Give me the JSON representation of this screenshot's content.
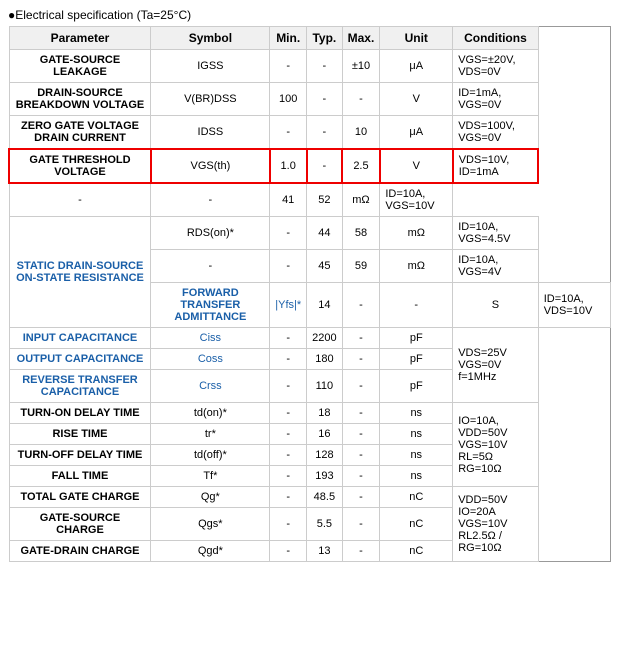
{
  "title": "Electrical specification (Ta=25°C)",
  "table": {
    "headers": [
      "Parameter",
      "Symbol",
      "Min.",
      "Typ.",
      "Max.",
      "Unit",
      "Conditions"
    ],
    "rows": [
      {
        "param": "GATE-SOURCE LEAKAGE",
        "symbol": "IGSS",
        "min": "-",
        "typ": "-",
        "max": "±10",
        "unit": "μA",
        "conditions": "VGS=±20V, VDS=0V",
        "highlight": false,
        "blue": false
      },
      {
        "param": "DRAIN-SOURCE BREAKDOWN VOLTAGE",
        "symbol": "V(BR)DSS",
        "min": "100",
        "typ": "-",
        "max": "-",
        "unit": "V",
        "conditions": "ID=1mA, VGS=0V",
        "highlight": false,
        "blue": false
      },
      {
        "param": "ZERO GATE VOLTAGE DRAIN CURRENT",
        "symbol": "IDSS",
        "min": "-",
        "typ": "-",
        "max": "10",
        "unit": "μA",
        "conditions": "VDS=100V, VGS=0V",
        "highlight": false,
        "blue": false
      },
      {
        "param": "GATE THRESHOLD VOLTAGE",
        "symbol": "VGS(th)",
        "min": "1.0",
        "typ": "-",
        "max": "2.5",
        "unit": "V",
        "conditions": "VDS=10V, ID=1mA",
        "highlight": true,
        "blue": false
      },
      {
        "param": "",
        "symbol": "-",
        "min": "-",
        "typ": "41",
        "max": "52",
        "unit": "mΩ",
        "conditions": "ID=10A, VGS=10V",
        "highlight": false,
        "blue": false,
        "subrow": true
      },
      {
        "param": "STATIC DRAIN-SOURCE ON-STATE RESISTANCE",
        "symbol": "RDS(on)*",
        "min": "-",
        "typ": "44",
        "max": "58",
        "unit": "mΩ",
        "conditions": "ID=10A, VGS=4.5V",
        "highlight": false,
        "blue": false,
        "multirow": true
      },
      {
        "param": "",
        "symbol": "-",
        "min": "-",
        "typ": "45",
        "max": "59",
        "unit": "mΩ",
        "conditions": "ID=10A, VGS=4V",
        "highlight": false,
        "blue": false,
        "subrow": true
      },
      {
        "param": "FORWARD TRANSFER ADMITTANCE",
        "symbol": "|Yfs|*",
        "min": "14",
        "typ": "-",
        "max": "-",
        "unit": "S",
        "conditions": "ID=10A, VDS=10V",
        "highlight": false,
        "blue": true
      },
      {
        "param": "INPUT CAPACITANCE",
        "symbol": "Ciss",
        "min": "-",
        "typ": "2200",
        "max": "-",
        "unit": "pF",
        "conditions": "",
        "highlight": false,
        "blue": true,
        "condgroup": "VDS=25V\nVGS=0V\nf=1MHz"
      },
      {
        "param": "OUTPUT CAPACITANCE",
        "symbol": "Coss",
        "min": "-",
        "typ": "180",
        "max": "-",
        "unit": "pF",
        "conditions": "",
        "highlight": false,
        "blue": true
      },
      {
        "param": "REVERSE TRANSFER CAPACITANCE",
        "symbol": "Crss",
        "min": "-",
        "typ": "110",
        "max": "-",
        "unit": "pF",
        "conditions": "",
        "highlight": false,
        "blue": true
      },
      {
        "param": "TURN-ON DELAY TIME",
        "symbol": "td(on)*",
        "min": "-",
        "typ": "18",
        "max": "-",
        "unit": "ns",
        "conditions": "",
        "highlight": false,
        "blue": false,
        "condgroup": "IO=10A, VDD=50V\nVGS=10V\nRL=5Ω\nRG=10Ω"
      },
      {
        "param": "RISE TIME",
        "symbol": "tr*",
        "min": "-",
        "typ": "16",
        "max": "-",
        "unit": "ns",
        "conditions": "",
        "highlight": false,
        "blue": false
      },
      {
        "param": "TURN-OFF DELAY TIME",
        "symbol": "td(off)*",
        "min": "-",
        "typ": "128",
        "max": "-",
        "unit": "ns",
        "conditions": "",
        "highlight": false,
        "blue": false
      },
      {
        "param": "FALL TIME",
        "symbol": "Tf*",
        "min": "-",
        "typ": "193",
        "max": "-",
        "unit": "ns",
        "conditions": "",
        "highlight": false,
        "blue": false
      },
      {
        "param": "TOTAL GATE CHARGE",
        "symbol": "Qg*",
        "min": "-",
        "typ": "48.5",
        "max": "-",
        "unit": "nC",
        "conditions": "",
        "highlight": false,
        "blue": false,
        "condgroup": "VDD=50V\nIO=20A\nVGS=10V\nRL2.5Ω / RG=10Ω"
      },
      {
        "param": "GATE-SOURCE CHARGE",
        "symbol": "Qgs*",
        "min": "-",
        "typ": "5.5",
        "max": "-",
        "unit": "nC",
        "conditions": "",
        "highlight": false,
        "blue": false
      },
      {
        "param": "GATE-DRAIN CHARGE",
        "symbol": "Qgd*",
        "min": "-",
        "typ": "13",
        "max": "-",
        "unit": "nC",
        "conditions": "",
        "highlight": false,
        "blue": false
      }
    ]
  }
}
